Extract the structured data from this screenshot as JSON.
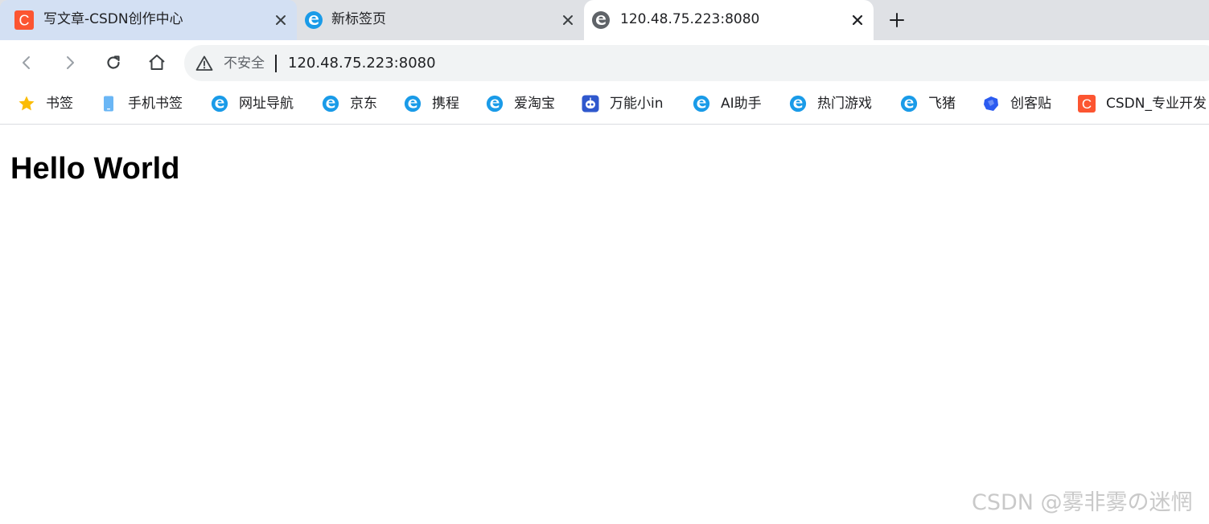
{
  "tabs": [
    {
      "title": "写文章-CSDN创作中心",
      "icon": "csdn-logo"
    },
    {
      "title": "新标签页",
      "icon": "edge-e-icon"
    },
    {
      "title": "120.48.75.223:8080",
      "icon": "edge-e-gray-icon"
    }
  ],
  "toolbar": {
    "security_label": "不安全",
    "url": "120.48.75.223:8080"
  },
  "bookmarks": [
    {
      "label": "书签",
      "icon": "star-icon"
    },
    {
      "label": "手机书签",
      "icon": "phone-icon"
    },
    {
      "label": "网址导航",
      "icon": "edge-e-icon"
    },
    {
      "label": "京东",
      "icon": "edge-e-icon"
    },
    {
      "label": "携程",
      "icon": "edge-e-icon"
    },
    {
      "label": "爱淘宝",
      "icon": "edge-e-icon"
    },
    {
      "label": "万能小in",
      "icon": "robot-icon"
    },
    {
      "label": "AI助手",
      "icon": "edge-e-icon"
    },
    {
      "label": "热门游戏",
      "icon": "edge-e-icon"
    },
    {
      "label": "飞猪",
      "icon": "edge-e-icon"
    },
    {
      "label": "创客贴",
      "icon": "chuangketie-icon"
    },
    {
      "label": "CSDN_专业开发",
      "icon": "csdn-logo"
    }
  ],
  "page": {
    "heading": "Hello World"
  },
  "watermark": "CSDN @雾非雾の迷惘",
  "colors": {
    "csdn_red": "#fc5531",
    "edge_blue": "#1a9be8",
    "tabstrip_bg": "#dfe1e5",
    "active_tab_tint": "#d3e0f3"
  }
}
